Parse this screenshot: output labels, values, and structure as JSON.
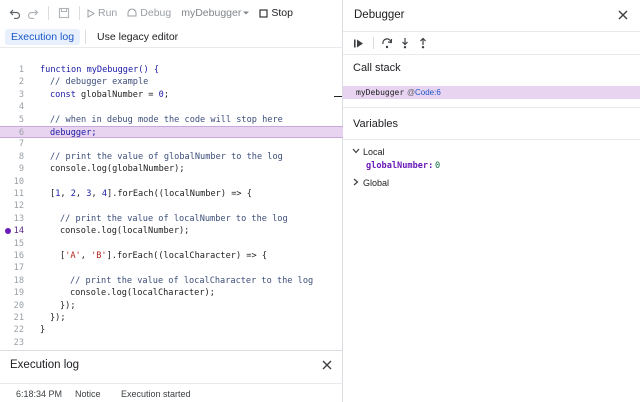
{
  "toolbar": {
    "run_label": "Run",
    "debug_label": "Debug",
    "function_select": "myDebugger",
    "stop_label": "Stop"
  },
  "mode_tabs": [
    "Execution log",
    "Use legacy editor"
  ],
  "editor": {
    "line_numbers": [
      "1",
      "2",
      "3",
      "4",
      "5",
      "6",
      "7",
      "8",
      "9",
      "10",
      "11",
      "12",
      "13",
      "14",
      "15",
      "16",
      "17",
      "18",
      "19",
      "20",
      "21",
      "22",
      "23"
    ],
    "highlighted_line": "6",
    "breakpoint_line": "14",
    "text": {
      "l1a": "function myDebugger() {",
      "l2": "// debugger example",
      "l3a": "const",
      "l3b": " globalNumber = ",
      "l3c": "0",
      "l3d": ";",
      "l5": "// when in debug mode the code will stop here",
      "l6": "debugger;",
      "l8": "// print the value of globalNumber to the log",
      "l9": "console.log(globalNumber);",
      "l11a": "[",
      "l11b": "1",
      "l11c": ", ",
      "l11d": "2",
      "l11e": ", ",
      "l11f": "3",
      "l11g": ", ",
      "l11h": "4",
      "l11i": "].forEach((localNumber) => {",
      "l13": "// print the value of localNumber to the log",
      "l14": "console.log(localNumber);",
      "l16a": "[",
      "l16b": "'A'",
      "l16c": ", ",
      "l16d": "'B'",
      "l16e": "].forEach((localCharacter) => {",
      "l18": "// print the value of localCharacter to the log",
      "l19": "console.log(localCharacter);",
      "l20": "});",
      "l21": "});",
      "l22": "}"
    }
  },
  "execution_log": {
    "title": "Execution log",
    "rows": [
      {
        "time": "6:18:34 PM",
        "type": "Notice",
        "message": "Execution started"
      }
    ]
  },
  "debugger": {
    "title": "Debugger",
    "call_stack_title": "Call stack",
    "call_stack": [
      {
        "function": "myDebugger",
        "at": "@",
        "location": "Code:6"
      }
    ],
    "variables_title": "Variables",
    "scopes": [
      {
        "label": "Local",
        "expanded": true,
        "vars": [
          {
            "name": "globalNumber:",
            "value": "0"
          }
        ]
      },
      {
        "label": "Global",
        "expanded": false,
        "vars": []
      }
    ]
  },
  "colors": {
    "highlight": "#e8d4f0",
    "breakpoint": "#6a1bb8",
    "accent": "#1a57c8"
  }
}
